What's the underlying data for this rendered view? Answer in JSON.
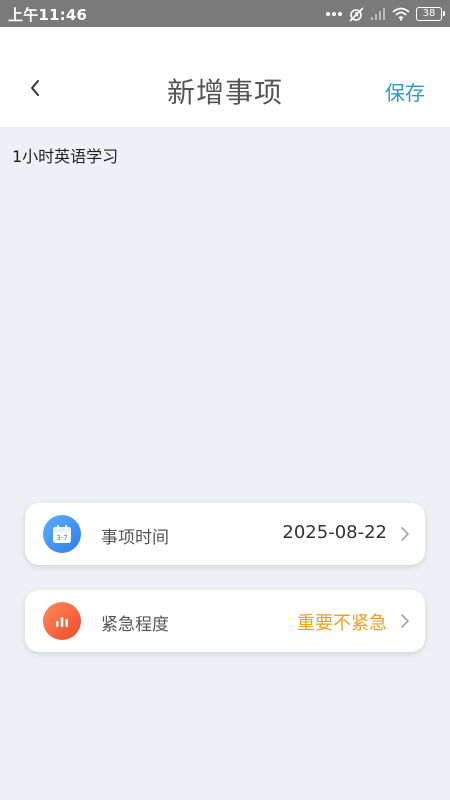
{
  "status_bar": {
    "time": "上午11:46",
    "battery": "38",
    "icons": [
      "more-dots-icon",
      "mute-alarm-icon",
      "signal-icon",
      "wifi-icon",
      "battery-icon"
    ]
  },
  "header": {
    "title": "新增事项",
    "save_label": "保存"
  },
  "item": {
    "text": "1小时英语学习"
  },
  "fields": {
    "time": {
      "label": "事项时间",
      "value": "2025-08-22",
      "icon": "calendar-icon"
    },
    "urgency": {
      "label": "紧急程度",
      "value": "重要不紧急",
      "icon": "bar-chart-icon"
    }
  },
  "colors": {
    "accent": "#2a9bc8",
    "urgency_value": "#f0a020",
    "background": "#eef0f5"
  }
}
